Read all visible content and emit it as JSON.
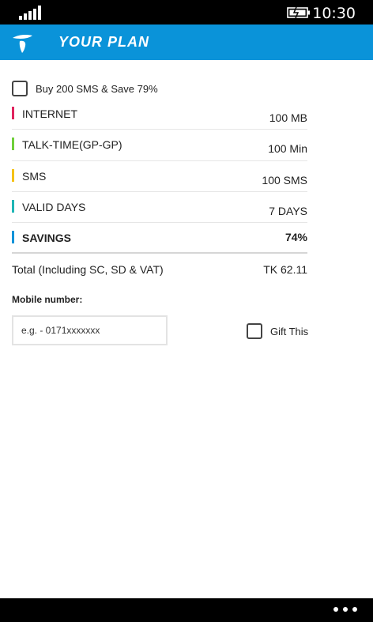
{
  "status_bar": {
    "time": "10:30"
  },
  "header": {
    "title": "YOUR PLAN"
  },
  "offer": {
    "label": "Buy 200 SMS & Save 79%",
    "checked": false
  },
  "details": [
    {
      "label": "INTERNET",
      "value": "100 MB",
      "color": "#e0245e"
    },
    {
      "label": "TALK-TIME(GP-GP)",
      "value": "100 Min",
      "color": "#6fcf3a"
    },
    {
      "label": "SMS",
      "value": "100 SMS",
      "color": "#f5c216"
    },
    {
      "label": "VALID DAYS",
      "value": "7 DAYS",
      "color": "#1fb5b5"
    },
    {
      "label": "SAVINGS",
      "value": "74%",
      "color": "#0a93d9"
    }
  ],
  "total": {
    "label": "Total (Including SC, SD & VAT)",
    "value": "TK 62.11"
  },
  "mobile": {
    "label": "Mobile number:",
    "placeholder": "e.g. - 0171xxxxxxx"
  },
  "gift": {
    "label": "Gift This",
    "checked": false
  },
  "colors": {
    "accent": "#0a93d9"
  }
}
